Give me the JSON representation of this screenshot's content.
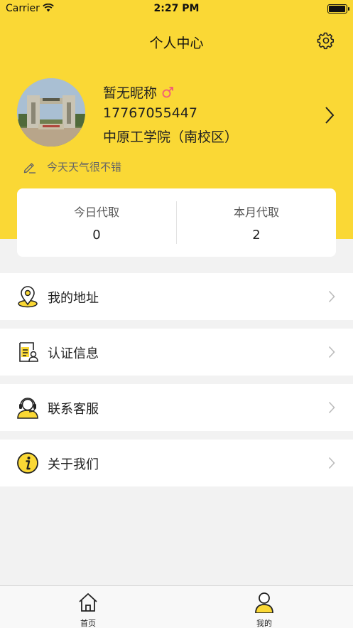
{
  "status_bar": {
    "carrier": "Carrier",
    "time": "2:27 PM",
    "battery_level": 1.0
  },
  "header": {
    "title": "个人中心"
  },
  "profile": {
    "nickname": "暂无昵称",
    "gender": "male",
    "phone": "17767055447",
    "school": "中原工学院（南校区）",
    "signature": "今天天气很不错"
  },
  "stats": [
    {
      "label": "今日代取",
      "value": "0"
    },
    {
      "label": "本月代取",
      "value": "2"
    }
  ],
  "menu": [
    {
      "label": "我的地址",
      "icon": "location-pin-icon"
    },
    {
      "label": "认证信息",
      "icon": "id-card-icon"
    },
    {
      "label": "联系客服",
      "icon": "customer-service-icon"
    },
    {
      "label": "关于我们",
      "icon": "info-icon"
    }
  ],
  "tab_bar": {
    "tabs": [
      {
        "label": "首页",
        "icon": "home-icon",
        "active": false
      },
      {
        "label": "我的",
        "icon": "person-icon",
        "active": true
      }
    ]
  },
  "colors": {
    "accent": "#fad835",
    "background": "#f2f2f2",
    "male_symbol": "#f25a7a"
  }
}
